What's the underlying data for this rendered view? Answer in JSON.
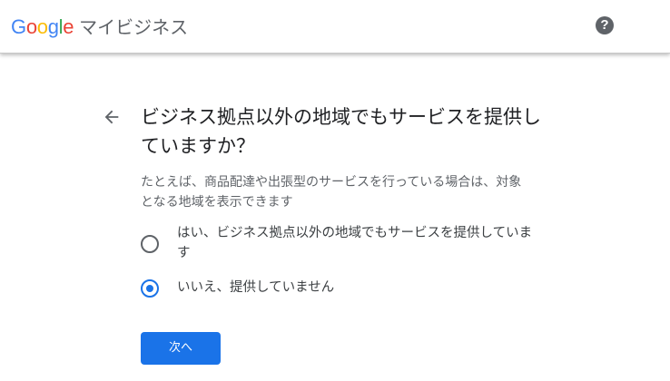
{
  "header": {
    "logo_letters": [
      {
        "char": "G",
        "color": "#4285F4"
      },
      {
        "char": "o",
        "color": "#EA4335"
      },
      {
        "char": "o",
        "color": "#FBBC05"
      },
      {
        "char": "g",
        "color": "#4285F4"
      },
      {
        "char": "l",
        "color": "#34A853"
      },
      {
        "char": "e",
        "color": "#EA4335"
      }
    ],
    "product_name": "マイビジネス",
    "help_icon": "question-mark-circle-icon",
    "help_glyph": "?"
  },
  "main": {
    "back_icon": "arrow-left-icon",
    "title": "ビジネス拠点以外の地域でもサービスを提供していますか？",
    "description": "たとえば、商品配達や出張型のサービスを行っている場合は、対象となる地域を表示できます",
    "options": [
      {
        "label": "はい、ビジネス拠点以外の地域でもサービスを提供しています",
        "selected": false
      },
      {
        "label": "いいえ、提供していません",
        "selected": true
      }
    ],
    "next_button_label": "次へ"
  },
  "colors": {
    "accent": "#1a73e8",
    "text_primary": "#202124",
    "text_secondary": "#5f6368"
  }
}
